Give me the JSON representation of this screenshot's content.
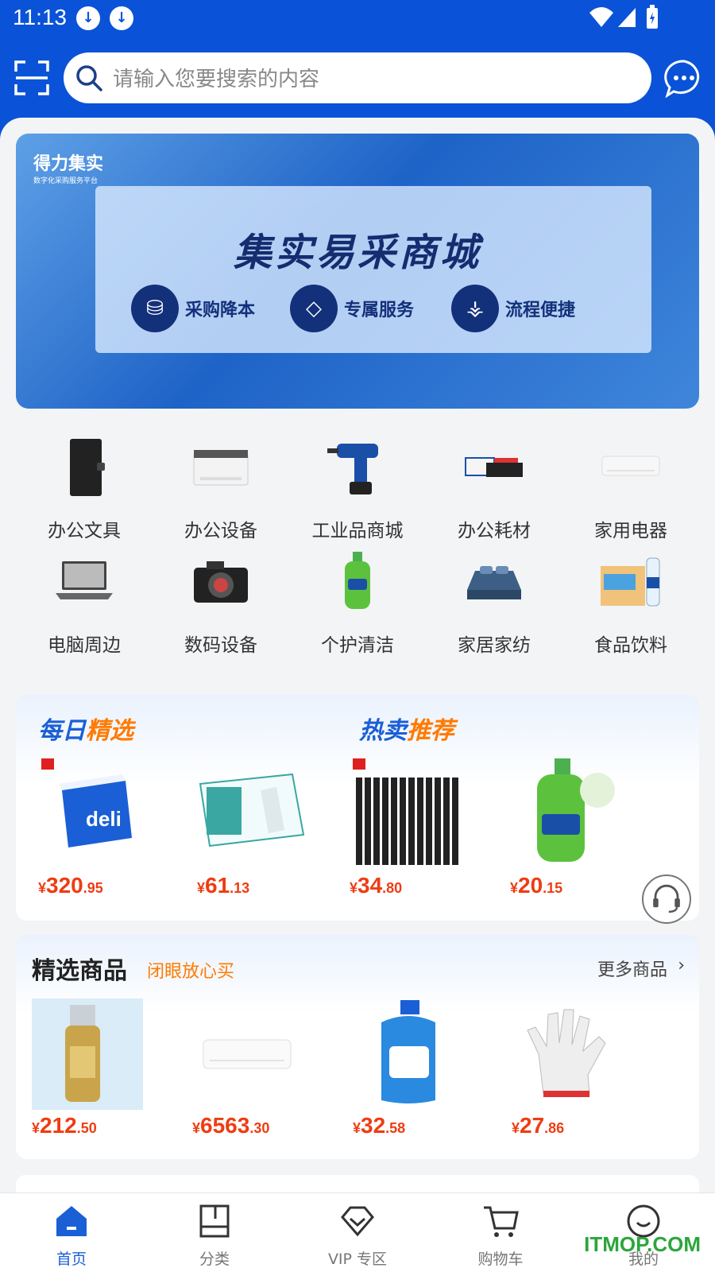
{
  "status_bar": {
    "time": "11:13"
  },
  "search": {
    "placeholder": "请输入您要搜索的内容"
  },
  "banner": {
    "brand": "得力集实",
    "brand_sub": "数字化采购服务平台",
    "title": "集实易采商城",
    "features": [
      "采购降本",
      "专属服务",
      "流程便捷"
    ]
  },
  "categories": [
    {
      "label": "办公文具",
      "icon": "notebook-icon"
    },
    {
      "label": "办公设备",
      "icon": "printer-icon"
    },
    {
      "label": "工业品商城",
      "icon": "drill-icon"
    },
    {
      "label": "办公耗材",
      "icon": "toner-icon"
    },
    {
      "label": "家用电器",
      "icon": "air-conditioner-icon"
    },
    {
      "label": "电脑周边",
      "icon": "laptop-icon"
    },
    {
      "label": "数码设备",
      "icon": "camera-icon"
    },
    {
      "label": "个护清洁",
      "icon": "handwash-icon"
    },
    {
      "label": "家居家纺",
      "icon": "bedding-icon"
    },
    {
      "label": "食品饮料",
      "icon": "drinks-icon"
    }
  ],
  "deals": {
    "daily": {
      "title_a": "每日",
      "title_b": "精选"
    },
    "hot": {
      "title_a": "热卖",
      "title_b": "推荐"
    },
    "products": [
      {
        "cur": "¥",
        "int": "320",
        "dec": ".95",
        "icon": "a4-paper-box-icon"
      },
      {
        "cur": "¥",
        "int": "61",
        "dec": ".13",
        "icon": "gloves-box-icon"
      },
      {
        "cur": "¥",
        "int": "34",
        "dec": ".80",
        "icon": "pens-icon"
      },
      {
        "cur": "¥",
        "int": "20",
        "dec": ".15",
        "icon": "handwash-bottle-icon"
      }
    ]
  },
  "selected": {
    "title": "精选商品",
    "subtitle": "闭眼放心买",
    "more": "更多商品",
    "products": [
      {
        "cur": "¥",
        "int": "212",
        "dec": ".50",
        "icon": "sunscreen-icon"
      },
      {
        "cur": "¥",
        "int": "6563",
        "dec": ".30",
        "icon": "air-conditioner-icon"
      },
      {
        "cur": "¥",
        "int": "32",
        "dec": ".58",
        "icon": "detergent-icon"
      },
      {
        "cur": "¥",
        "int": "27",
        "dec": ".86",
        "icon": "work-glove-icon"
      }
    ]
  },
  "tabs": [
    {
      "label": "首页",
      "active": true
    },
    {
      "label": "分类",
      "active": false
    },
    {
      "label": "VIP 专区",
      "active": false
    },
    {
      "label": "购物车",
      "active": false
    },
    {
      "label": "我的",
      "active": false
    }
  ],
  "watermark": "ITMOP.COM",
  "colors": {
    "primary": "#0a53d8",
    "price": "#ef3c12",
    "accent": "#ff7a00"
  }
}
